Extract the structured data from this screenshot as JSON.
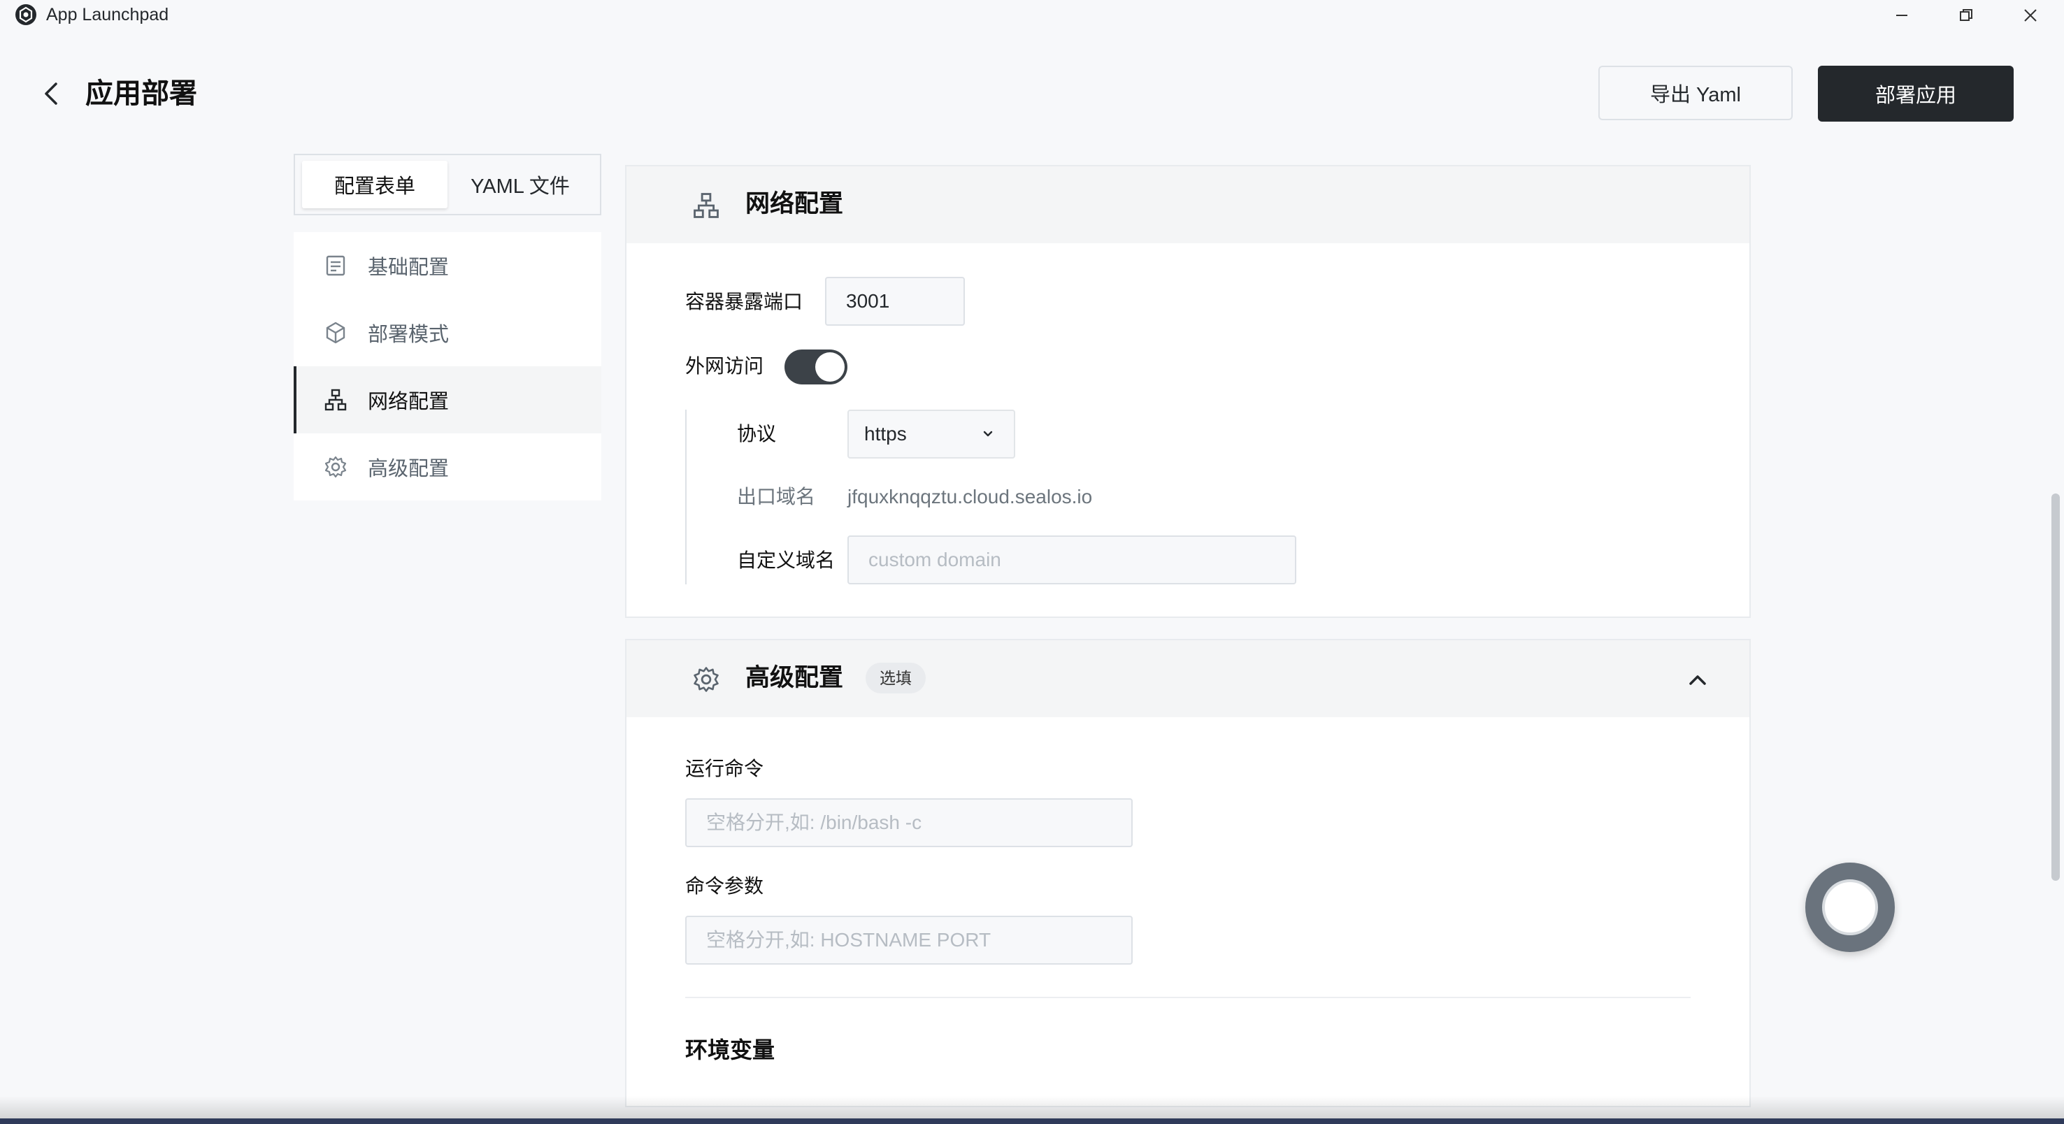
{
  "window": {
    "title": "App Launchpad",
    "controls": [
      "minimize-icon",
      "restore-icon",
      "close-icon"
    ]
  },
  "header": {
    "title": "应用部署",
    "export_label": "导出 Yaml",
    "deploy_label": "部署应用"
  },
  "tabs": [
    {
      "label": "配置表单",
      "active": true
    },
    {
      "label": "YAML 文件",
      "active": false
    }
  ],
  "nav": [
    {
      "label": "基础配置",
      "icon": "document-icon",
      "active": false
    },
    {
      "label": "部署模式",
      "icon": "cube-icon",
      "active": false
    },
    {
      "label": "网络配置",
      "icon": "network-icon",
      "active": true
    },
    {
      "label": "高级配置",
      "icon": "gear-icon",
      "active": false
    }
  ],
  "network": {
    "title": "网络配置",
    "port_label": "容器暴露端口",
    "port_value": "3001",
    "public_access_label": "外网访问",
    "public_access_enabled": true,
    "protocol_label": "协议",
    "protocol_value": "https",
    "domain_label": "出口域名",
    "domain_value": "jfquxknqqztu.cloud.sealos.io",
    "custom_domain_label": "自定义域名",
    "custom_domain_placeholder": "custom domain"
  },
  "advanced": {
    "title": "高级配置",
    "badge": "选填",
    "command_label": "运行命令",
    "command_placeholder": "空格分开,如: /bin/bash -c",
    "args_label": "命令参数",
    "args_placeholder": "空格分开,如: HOSTNAME PORT",
    "env_title": "环境变量"
  },
  "colors": {
    "primary": "#24282c",
    "background": "#f7f8fa",
    "card_header": "#f4f5f6",
    "border": "#dde1e6"
  }
}
